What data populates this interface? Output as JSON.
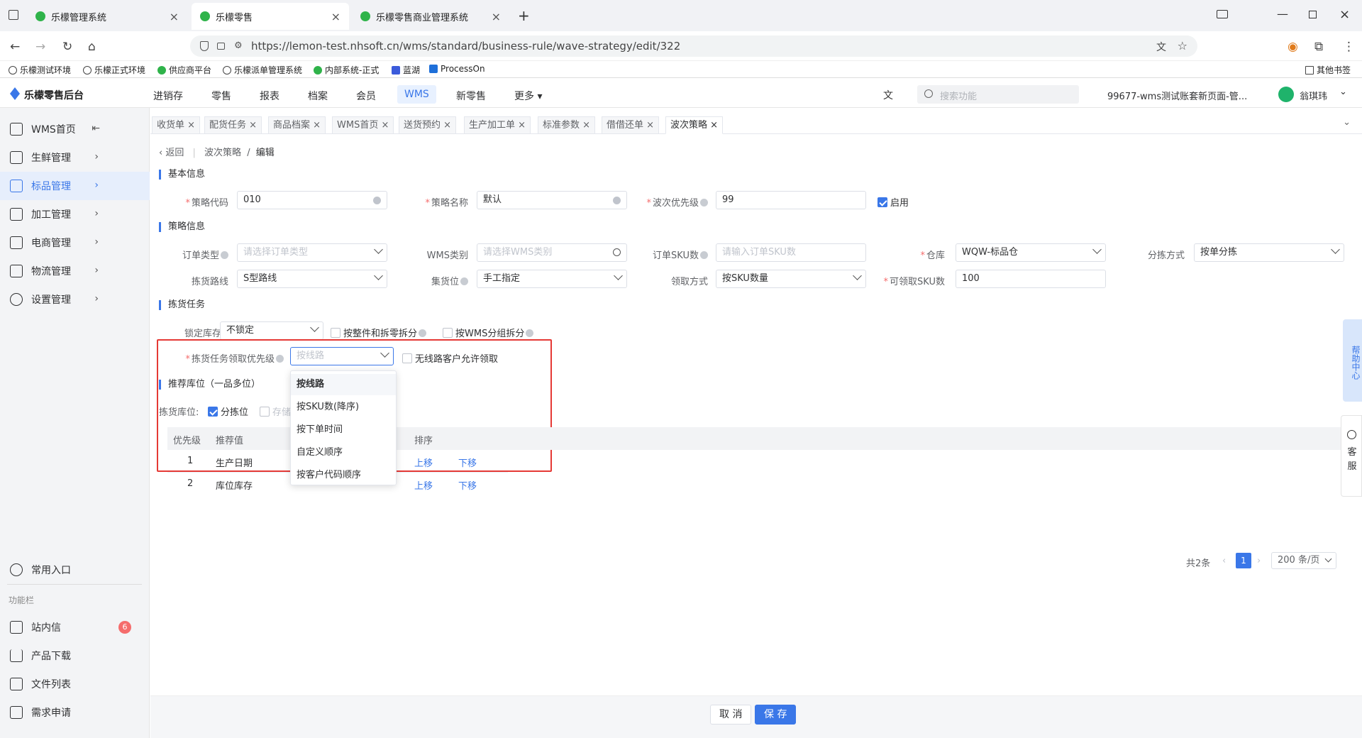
{
  "browser": {
    "tabs": [
      {
        "title": "乐檬管理系统"
      },
      {
        "title": "乐檬零售"
      },
      {
        "title": "乐檬零售商业管理系统"
      }
    ],
    "url": "https://lemon-test.nhsoft.cn/wms/standard/business-rule/wave-strategy/edit/322",
    "bookmarks": [
      "乐檬测试环境",
      "乐檬正式环境",
      "供应商平台",
      "乐檬派单管理系统",
      "内部系统-正式",
      "蓝湖",
      "ProcessOn"
    ],
    "other_bookmarks": "其他书签"
  },
  "app": {
    "logo": "乐檬零售后台",
    "nav": [
      "进销存",
      "零售",
      "报表",
      "档案",
      "会员",
      "WMS",
      "新零售",
      "更多"
    ],
    "search_placeholder": "搜索功能",
    "account": "99677-wms测试账套新页面-管...",
    "user": "翁琪玮"
  },
  "sidebar": {
    "items": [
      {
        "label": "WMS首页"
      },
      {
        "label": "生鲜管理"
      },
      {
        "label": "标品管理"
      },
      {
        "label": "加工管理"
      },
      {
        "label": "电商管理"
      },
      {
        "label": "物流管理"
      },
      {
        "label": "设置管理"
      }
    ],
    "common_entry": "常用入口",
    "func_title": "功能栏",
    "func_items": [
      {
        "label": "站内信",
        "badge": "6"
      },
      {
        "label": "产品下载"
      },
      {
        "label": "文件列表"
      },
      {
        "label": "需求申请"
      }
    ]
  },
  "page_tabs": [
    "收货单",
    "配货任务",
    "商品档案",
    "WMS首页",
    "送货预约",
    "生产加工单",
    "标准参数",
    "借借还单",
    "波次策略"
  ],
  "breadcrumb": {
    "back": "返回",
    "parent": "波次策略",
    "current": "编辑"
  },
  "basic": {
    "title": "基本信息",
    "code_label": "策略代码",
    "code_value": "010",
    "name_label": "策略名称",
    "name_value": "默认",
    "priority_label": "波次优先级",
    "priority_value": "99",
    "enable_label": "启用"
  },
  "strategy": {
    "title": "策略信息",
    "order_type_label": "订单类型",
    "order_type_ph": "请选择订单类型",
    "wms_type_label": "WMS类别",
    "wms_type_ph": "请选择WMS类别",
    "sku_count_label": "订单SKU数",
    "sku_count_ph": "请输入订单SKU数",
    "warehouse_label": "仓库",
    "warehouse_value": "WQW-标品仓",
    "sort_label": "分拣方式",
    "sort_value": "按单分拣",
    "route_label": "拣货路线",
    "route_value": "S型路线",
    "collect_label": "集货位",
    "collect_value": "手工指定",
    "claim_label": "领取方式",
    "claim_value": "按SKU数量",
    "claim_sku_label": "可领取SKU数",
    "claim_sku_value": "100"
  },
  "picking": {
    "title": "拣货任务",
    "lock_label": "锁定库存",
    "lock_value": "不锁定",
    "split_label": "按整件和拆零拆分",
    "wms_split_label": "按WMS分组拆分",
    "claim_priority_label": "拣货任务领取优先级",
    "claim_priority_ph": "按线路",
    "no_route_label": "无线路客户允许领取",
    "dropdown_options": [
      "按线路",
      "按SKU数(降序)",
      "按下单时间",
      "自定义顺序",
      "按客户代码顺序"
    ]
  },
  "recommend": {
    "title": "推荐库位（一品多位）",
    "location_label": "拣货库位:",
    "sort_loc_label": "分拣位",
    "storage_loc_label": "存储",
    "columns": [
      "优先级",
      "推荐值",
      "排序"
    ],
    "rows": [
      {
        "priority": "1",
        "value": "生产日期",
        "up": "上移",
        "down": "下移"
      },
      {
        "priority": "2",
        "value": "库位库存",
        "up": "上移",
        "down": "下移"
      }
    ]
  },
  "pagination": {
    "total": "共2条",
    "page": "1",
    "size": "200 条/页"
  },
  "footer": {
    "cancel": "取 消",
    "save": "保 存"
  },
  "help": {
    "help_center": "帮助中心",
    "service": "客服"
  },
  "colors": {
    "accent": "#3a77e8",
    "highlight_border": "#e53935"
  }
}
